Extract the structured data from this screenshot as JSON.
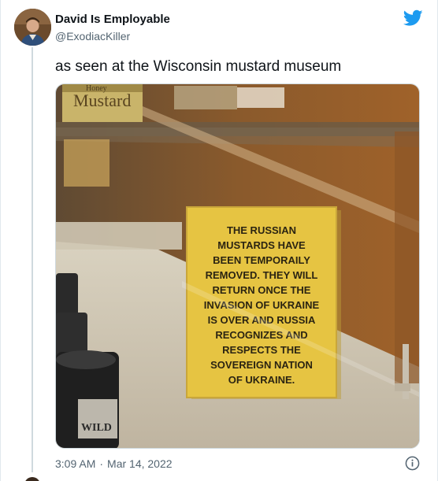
{
  "author": {
    "display_name": "David Is Employable",
    "handle": "@ExodiacKiller"
  },
  "tweet": {
    "text": "as seen at the Wisconsin mustard museum",
    "time": "3:09 AM",
    "separator": "·",
    "date": "Mar 14, 2022"
  },
  "photo": {
    "jar_label": "Mustard",
    "jar_label_top": "Honey",
    "sign_lines": [
      "THE RUSSIAN",
      "MUSTARDS HAVE",
      "BEEN TEMPORAILY",
      "REMOVED. THEY WILL",
      "RETURN ONCE THE",
      "INVASION OF UKRAINE",
      "IS OVER AND RUSSIA",
      "RECOGNIZES AND",
      "RESPECTS THE",
      "SOVEREIGN NATION",
      "OF UKRAINE."
    ],
    "bottom_jar_text": "WILD"
  },
  "icons": {
    "logo": "twitter-bird-icon",
    "info": "info-icon"
  },
  "colors": {
    "twitter_blue": "#1d9bf0",
    "sign_yellow": "#e6c442",
    "secondary_text": "#536471"
  }
}
